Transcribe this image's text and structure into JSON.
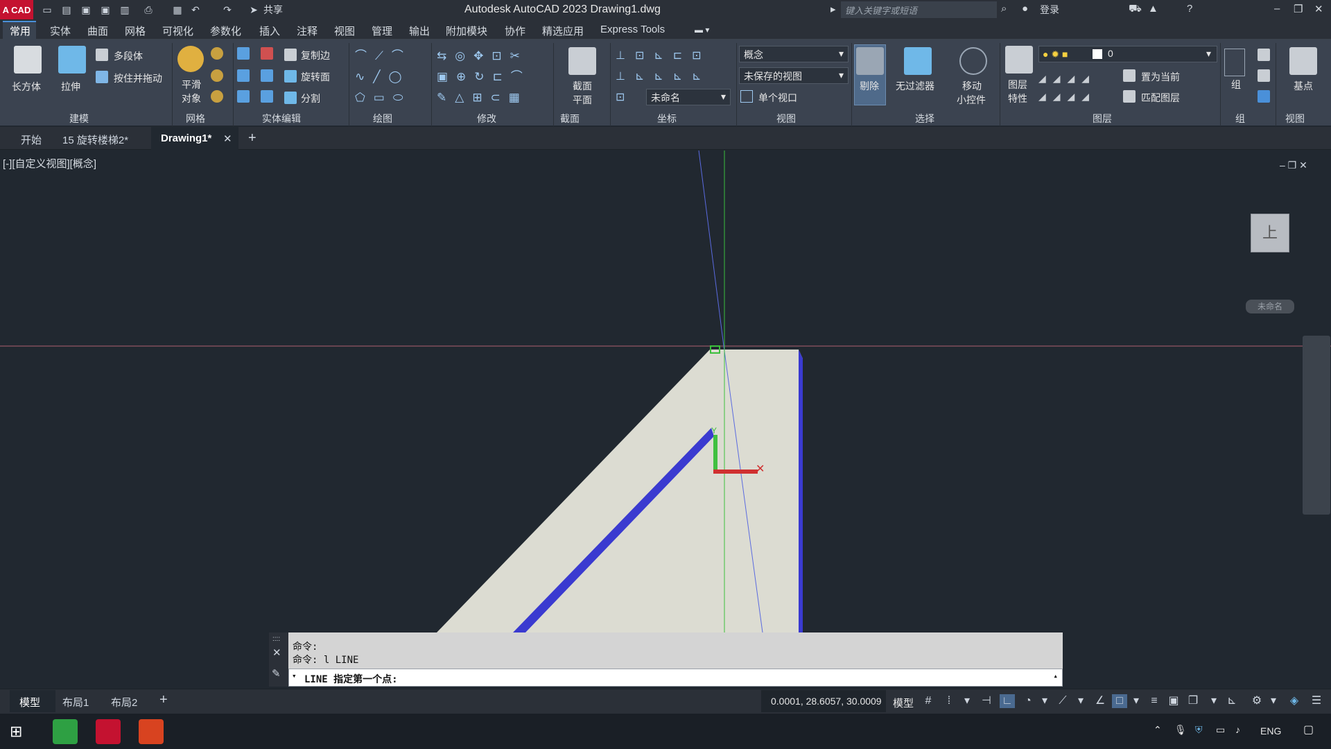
{
  "titlebar": {
    "logo": "A CAD",
    "share_label": "共享",
    "app_title": "Autodesk AutoCAD 2023    Drawing1.dwg",
    "search_placeholder": "键入关键字或短语",
    "login_label": "登录"
  },
  "menu_tabs": [
    "常用",
    "实体",
    "曲面",
    "网格",
    "可视化",
    "参数化",
    "插入",
    "注释",
    "视图",
    "管理",
    "输出",
    "附加模块",
    "协作",
    "精选应用",
    "Express Tools"
  ],
  "ribbon": {
    "modeling": {
      "box_label": "长方体",
      "extrude_label": "拉伸",
      "polysolid_label": "多段体",
      "presspull_label": "按住并拖动",
      "title": "建模"
    },
    "mesh": {
      "smooth_label_1": "平滑",
      "smooth_label_2": "对象",
      "title": "网格"
    },
    "solid_edit": {
      "copy_edges": "复制边",
      "revolve_face": "旋转面",
      "slice": "分割",
      "title": "实体编辑"
    },
    "draw": {
      "title": "绘图"
    },
    "modify": {
      "title": "修改"
    },
    "section": {
      "label_1": "截面",
      "label_2": "平面",
      "title": "截面"
    },
    "coordinates": {
      "ucs_name": "未命名",
      "title": "坐标"
    },
    "view": {
      "visual_style": "概念",
      "saved_view": "未保存的视图",
      "viewport_config": "单个视口",
      "title": "视图"
    },
    "selection": {
      "cull_label": "剔除",
      "nofilter_label": "无过滤器",
      "gizmo_label_1": "移动",
      "gizmo_label_2": "小控件",
      "title": "选择"
    },
    "layers": {
      "props_label_1": "图层",
      "props_label_2": "特性",
      "layer_name": "0",
      "set_current": "置为当前",
      "match_layer": "匹配图层",
      "title": "图层"
    },
    "groups": {
      "group_label": "组",
      "title": "组"
    },
    "view2": {
      "basepoint_label": "基点",
      "title": "视图"
    }
  },
  "file_tabs": [
    "开始",
    "15 旋转楼梯2*",
    "Drawing1*"
  ],
  "viewport": {
    "label": "[-][自定义视图][概念]",
    "viewcube_face": "上",
    "ucs_label": "未命名"
  },
  "command": {
    "history": [
      "命令:",
      "命令: l LINE"
    ],
    "prompt": "LINE 指定第一个点:"
  },
  "status": {
    "layout_tabs": [
      "模型",
      "布局1",
      "布局2"
    ],
    "coordinates": "0.0001, 28.6057, 30.0009",
    "model_label": "模型"
  },
  "taskbar": {
    "language": "ENG"
  },
  "colors": {
    "accent": "#4a90d9",
    "drawing_face": "#dcdcd2",
    "drawing_edge": "#3a3ad0",
    "red_axis": "#d03030",
    "green_axis": "#30c030"
  }
}
